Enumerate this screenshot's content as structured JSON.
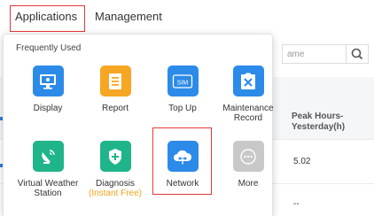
{
  "nav": {
    "tabs": [
      {
        "label": "Applications"
      },
      {
        "label": "Management"
      }
    ]
  },
  "background": {
    "search_placeholder": "ame",
    "column_header": "Peak Hours-Yesterday(h)",
    "cells": [
      "5.02",
      "--"
    ]
  },
  "panel": {
    "section_title": "Frequently Used",
    "apps": [
      {
        "label": "Display",
        "icon": "monitor-icon",
        "color": "#2c8ae8"
      },
      {
        "label": "Report",
        "icon": "document-icon",
        "color": "#f5a623"
      },
      {
        "label": "Top Up",
        "icon": "sim-card-icon",
        "color": "#2c8ae8",
        "icon_text": "SIM"
      },
      {
        "label": "Maintenance Record",
        "icon": "tools-icon",
        "color": "#2c8ae8"
      },
      {
        "label": "Virtual Weather Station",
        "icon": "satellite-dish-icon",
        "color": "#1fb48a"
      },
      {
        "label": "Diagnosis",
        "sublabel": "(Instant Free)",
        "icon": "shield-plus-icon",
        "color": "#1fb48a"
      },
      {
        "label": "Network",
        "icon": "cloud-network-icon",
        "color": "#2c8ae8"
      },
      {
        "label": "More",
        "icon": "more-dots-icon",
        "color": "#c8c8c8"
      }
    ]
  },
  "highlight_color": "#e53935"
}
